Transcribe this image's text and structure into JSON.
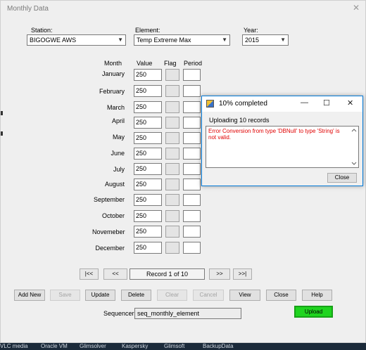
{
  "window": {
    "title": "Monthly Data"
  },
  "station": {
    "label": "Station:",
    "value": "BIGOGWE AWS"
  },
  "element": {
    "label": "Element:",
    "value": "Temp Extreme Max"
  },
  "year": {
    "label": "Year:",
    "value": "2015"
  },
  "grid": {
    "headers": {
      "month": "Month",
      "value": "Value",
      "flag": "Flag",
      "period": "Period"
    },
    "rows": [
      {
        "month": "January",
        "value": "250"
      },
      {
        "month": "February",
        "value": "250"
      },
      {
        "month": "March",
        "value": "250"
      },
      {
        "month": "April",
        "value": "250"
      },
      {
        "month": "May",
        "value": "250"
      },
      {
        "month": "June",
        "value": "250"
      },
      {
        "month": "July",
        "value": "250"
      },
      {
        "month": "August",
        "value": "250"
      },
      {
        "month": "September",
        "value": "250"
      },
      {
        "month": "October",
        "value": "250"
      },
      {
        "month": "Novemeber",
        "value": "250"
      },
      {
        "month": "December",
        "value": "250"
      }
    ]
  },
  "navigation": {
    "first": "|<<",
    "prev": "<<",
    "record": "Record 1 of 10",
    "next": ">>",
    "last": ">>|"
  },
  "actions": {
    "add_new": "Add New",
    "save": "Save",
    "update": "Update",
    "delete": "Delete",
    "clear": "Clear",
    "cancel": "Cancel",
    "view": "View",
    "close": "Close",
    "help": "Help"
  },
  "sequencer": {
    "label": "Sequencer:",
    "value": "seq_monthly_element"
  },
  "upload": {
    "label": "Upload",
    "color": "#1fd41f"
  },
  "progress_dialog": {
    "title": "10% completed",
    "progress_percent": 10,
    "message": "Uploading 10 records",
    "error_text": "Error Conversion from type 'DBNull' to type 'String' is not valid.",
    "error_color": "#e00000",
    "close_label": "Close"
  },
  "taskbar": {
    "items": [
      "VLC media",
      "Oracle VM",
      "Glimsolver",
      "Kaspersky",
      "Glimsoft",
      "BackupData"
    ]
  }
}
